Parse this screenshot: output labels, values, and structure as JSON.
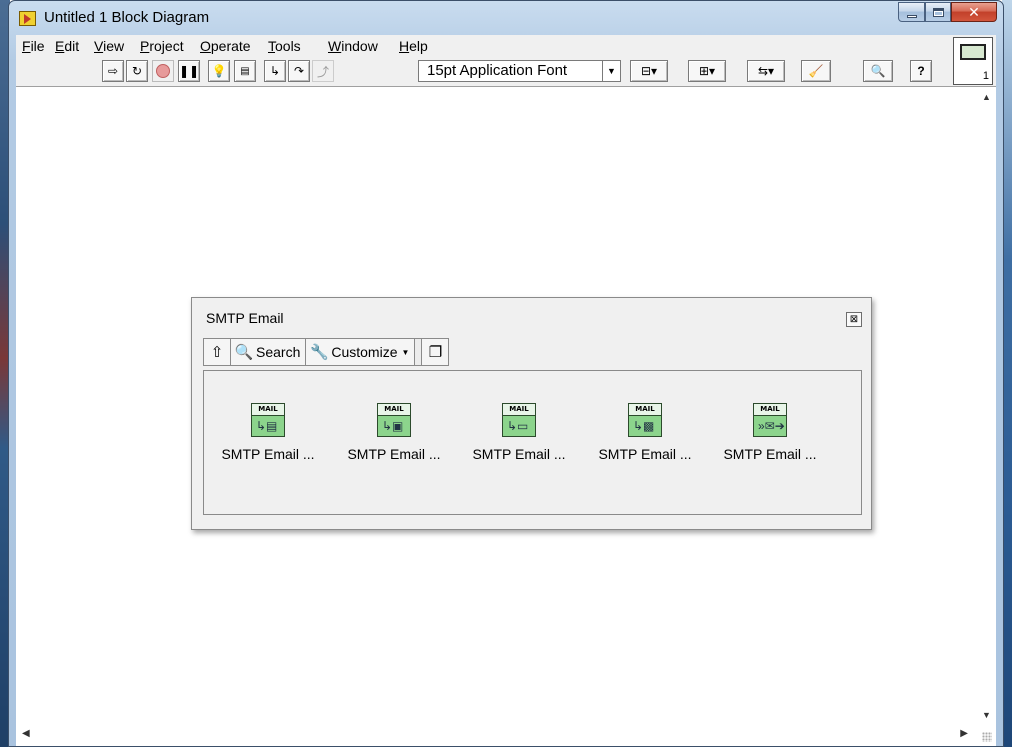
{
  "window": {
    "title": "Untitled 1 Block Diagram"
  },
  "menu": [
    {
      "label": "File",
      "mnemonic": "F",
      "rest": "ile"
    },
    {
      "label": "Edit",
      "mnemonic": "E",
      "rest": "dit"
    },
    {
      "label": "View",
      "mnemonic": "V",
      "rest": "iew"
    },
    {
      "label": "Project",
      "mnemonic": "P",
      "rest": "roject"
    },
    {
      "label": "Operate",
      "mnemonic": "O",
      "rest": "perate"
    },
    {
      "label": "Tools",
      "mnemonic": "T",
      "rest": "ools"
    },
    {
      "label": "Window",
      "mnemonic": "W",
      "rest": "indow"
    },
    {
      "label": "Help",
      "mnemonic": "H",
      "rest": "elp"
    }
  ],
  "toolbar": {
    "font": "15pt Application Font",
    "context_help_number": "1"
  },
  "palette": {
    "title": "SMTP Email",
    "search_label": "Search",
    "customize_label": "Customize",
    "close_glyph": "⊠",
    "items": [
      {
        "label": "SMTP Email ...",
        "icon": "mail-attachment-icon"
      },
      {
        "label": "SMTP Email ...",
        "icon": "mail-html-icon"
      },
      {
        "label": "SMTP Email ...",
        "icon": "mail-file-icon"
      },
      {
        "label": "SMTP Email ...",
        "icon": "mail-array-icon"
      },
      {
        "label": "SMTP Email ...",
        "icon": "mail-send-icon"
      }
    ],
    "icon_band_text": "MAIL"
  },
  "colors": {
    "vi_icon_green": "#8cd48c",
    "title_bar_blue": "#b3cbe4",
    "close_red": "#c2402a"
  }
}
